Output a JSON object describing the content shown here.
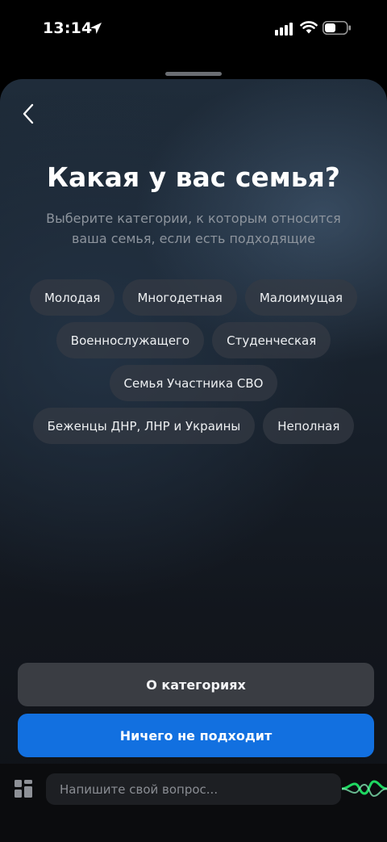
{
  "status_bar": {
    "time": "13:14"
  },
  "header": {
    "title": "Какая у вас семья?",
    "subtitle": "Выберите категории, к которым относится ваша семья, если есть подходящие"
  },
  "categories": [
    [
      "Молодая",
      "Многодетная",
      "Малоимущая"
    ],
    [
      "Военнослужащего",
      "Студенческая"
    ],
    [
      "Семья Участника СВО"
    ],
    [
      "Беженцы ДНР, ЛНР и Украины",
      "Неполная"
    ]
  ],
  "actions": {
    "about_label": "О категориях",
    "none_label": "Ничего не подходит"
  },
  "input_bar": {
    "placeholder": "Напишите свой вопрос..."
  },
  "colors": {
    "primary": "#1270e0",
    "secondary_button": "#3a3d43",
    "chip_background": "#343a44",
    "voice_accent": "#1ed760"
  }
}
